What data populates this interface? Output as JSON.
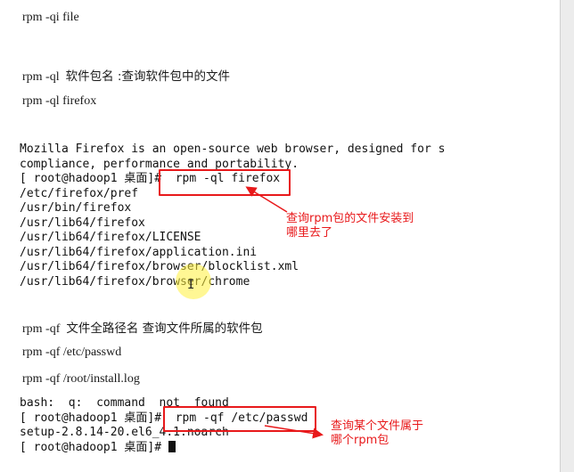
{
  "sections": {
    "intro_command": "rpm -qi file",
    "ql_heading": {
      "cmd": "rpm -ql",
      "desc": "软件包名  :查询软件包中的文件"
    },
    "ql_example": "rpm -ql firefox",
    "qf_heading": {
      "cmd": "rpm -qf",
      "desc": "文件全路径名  查询文件所属的软件包"
    },
    "qf_example1": "rpm -qf /etc/passwd",
    "qf_example2": "rpm -qf /root/install.log"
  },
  "terminal1": {
    "lines": [
      "Mozilla Firefox is an open-source web browser, designed for s",
      "compliance, performance and portability.",
      "[ root@hadoop1 桌面]#  rpm -ql firefox",
      "/etc/firefox/pref",
      "/usr/bin/firefox",
      "/usr/lib64/firefox",
      "/usr/lib64/firefox/LICENSE",
      "/usr/lib64/firefox/application.ini",
      "/usr/lib64/firefox/browser/blocklist.xml",
      "/usr/lib64/firefox/browser/chrome"
    ],
    "annotation": "查询rpm包的文件安装到\n哪里去了"
  },
  "terminal2": {
    "lines": [
      "bash:  q:  command  not  found",
      "[ root@hadoop1 桌面]#  rpm -qf /etc/passwd",
      "setup-2.8.14-20.el6_4.1.noarch",
      "[ root@hadoop1 桌面]#"
    ],
    "annotation": "查询某个文件属于\n哪个rpm包"
  },
  "colors": {
    "annotation": "#e8191b",
    "highlight": "#fff03c"
  }
}
